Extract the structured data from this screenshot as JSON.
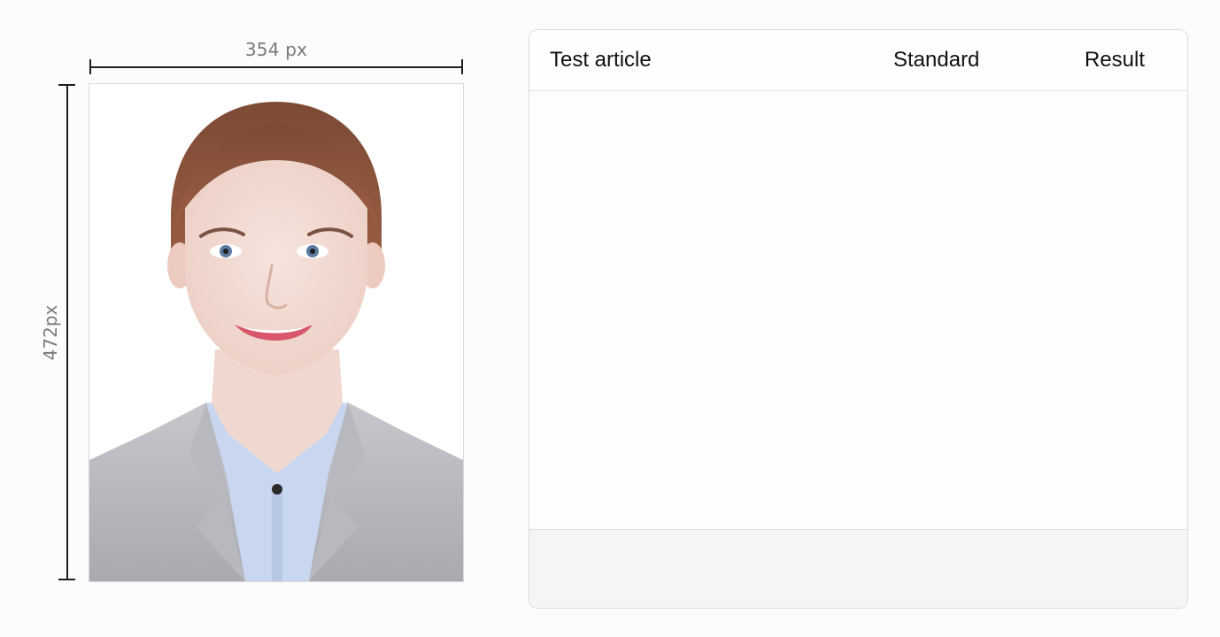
{
  "photo_spec": {
    "width_label": "354 px",
    "height_label": "472px"
  },
  "results_table": {
    "columns": [
      "Test article",
      "Standard",
      "Result"
    ],
    "rows": []
  },
  "colors": {
    "background": "#fcfcfd",
    "panel_border": "#dcdcdc",
    "footer_fill": "#f5f5f6",
    "dimension_line": "#1f1f1f",
    "dimension_text": "#7a7a7a"
  }
}
